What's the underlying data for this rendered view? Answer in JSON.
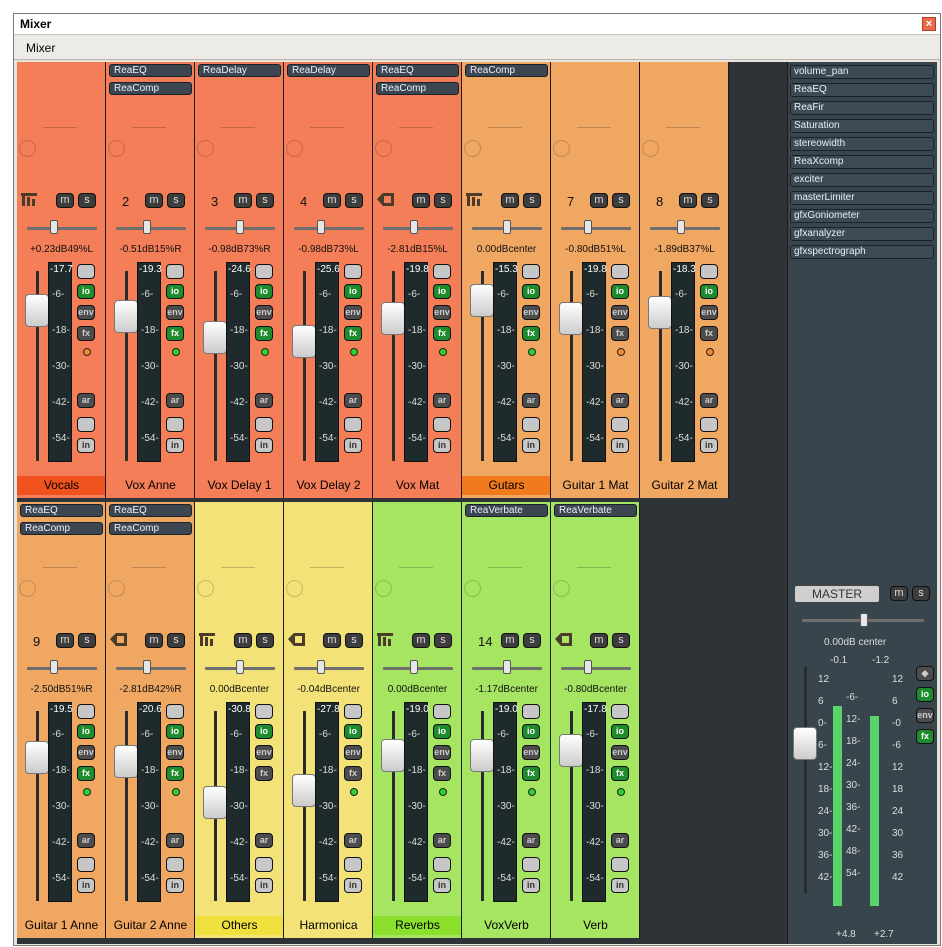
{
  "window": {
    "title": "Mixer",
    "tab_label": "Mixer",
    "close_glyph": "×"
  },
  "buttons": {
    "mute": "m",
    "solo": "s",
    "io": "io",
    "env": "env",
    "fx": "fx",
    "ar": "ar",
    "in": "in"
  },
  "tracks_row1": [
    {
      "num": "",
      "fx": [],
      "pan_text": "+0.23dB49%L",
      "peak": "-17.7",
      "name": "Vocals",
      "color": "#f47e57",
      "name_bg": "#f0521e",
      "folder": "parent",
      "fx_btn_active": false,
      "rec_dot": "orange"
    },
    {
      "num": "2",
      "fx": [
        "ReaEQ",
        "ReaComp"
      ],
      "pan_text": "-0.51dB15%R",
      "peak": "-19.3",
      "name": "Vox Anne",
      "color": "#f47e57",
      "name_bg": "#f47e57",
      "folder": "",
      "fx_btn_active": true,
      "rec_dot": "green"
    },
    {
      "num": "3",
      "fx": [
        "ReaDelay"
      ],
      "pan_text": "-0.98dB73%R",
      "peak": "-24.6",
      "name": "Vox Delay 1",
      "color": "#f47e57",
      "name_bg": "#f47e57",
      "folder": "",
      "fx_btn_active": true,
      "rec_dot": "green"
    },
    {
      "num": "4",
      "fx": [
        "ReaDelay"
      ],
      "pan_text": "-0.98dB73%L",
      "peak": "-25.6",
      "name": "Vox Delay 2",
      "color": "#f47e57",
      "name_bg": "#f47e57",
      "folder": "",
      "fx_btn_active": true,
      "rec_dot": "green"
    },
    {
      "num": "",
      "fx": [
        "ReaEQ",
        "ReaComp"
      ],
      "pan_text": "-2.81dB15%L",
      "peak": "-19.8",
      "name": "Vox Mat",
      "color": "#f47e57",
      "name_bg": "#f47e57",
      "folder": "child",
      "fx_btn_active": true,
      "rec_dot": "green"
    },
    {
      "num": "",
      "fx": [
        "ReaComp"
      ],
      "pan_text": "0.00dBcenter",
      "peak": "-15.3",
      "name": "Gutars",
      "color": "#f0a762",
      "name_bg": "#f07a1c",
      "folder": "parent",
      "fx_btn_active": true,
      "rec_dot": "green"
    },
    {
      "num": "7",
      "fx": [],
      "pan_text": "-0.80dB51%L",
      "peak": "-19.8",
      "name": "Guitar 1 Mat",
      "color": "#f0a762",
      "name_bg": "#f0a762",
      "folder": "",
      "fx_btn_active": false,
      "rec_dot": "orange"
    },
    {
      "num": "8",
      "fx": [],
      "pan_text": "-1.89dB37%L",
      "peak": "-18.3",
      "name": "Guitar 2 Mat",
      "color": "#f0a762",
      "name_bg": "#f0a762",
      "folder": "",
      "fx_btn_active": false,
      "rec_dot": "orange"
    }
  ],
  "tracks_row2": [
    {
      "num": "9",
      "fx": [
        "ReaEQ",
        "ReaComp"
      ],
      "pan_text": "-2.50dB51%R",
      "peak": "-19.5",
      "name": "Guitar 1 Anne",
      "color": "#f0a762",
      "name_bg": "#f0a762",
      "folder": "",
      "fx_btn_active": true,
      "rec_dot": "green"
    },
    {
      "num": "",
      "fx": [
        "ReaEQ",
        "ReaComp"
      ],
      "pan_text": "-2.81dB42%R",
      "peak": "-20.6",
      "name": "Guitar 2 Anne",
      "color": "#f0a762",
      "name_bg": "#f0a762",
      "folder": "child",
      "fx_btn_active": true,
      "rec_dot": "green"
    },
    {
      "num": "",
      "fx": [],
      "pan_text": "0.00dBcenter",
      "peak": "-30.8",
      "name": "Others",
      "color": "#f3e277",
      "name_bg": "#efe03d",
      "folder": "parent",
      "fx_btn_active": false,
      "rec_dot": "none"
    },
    {
      "num": "",
      "fx": [],
      "pan_text": "-0.04dBcenter",
      "peak": "-27.8",
      "name": "Harmonica",
      "color": "#f3e277",
      "name_bg": "#f3e277",
      "folder": "child",
      "fx_btn_active": false,
      "rec_dot": "green"
    },
    {
      "num": "",
      "fx": [],
      "pan_text": "0.00dBcenter",
      "peak": "-19.0",
      "name": "Reverbs",
      "color": "#a6e562",
      "name_bg": "#8be02e",
      "folder": "parent",
      "fx_btn_active": false,
      "rec_dot": "green"
    },
    {
      "num": "14",
      "fx": [
        "ReaVerbate"
      ],
      "pan_text": "-1.17dBcenter",
      "peak": "-19.0",
      "name": "VoxVerb",
      "color": "#a6e562",
      "name_bg": "#a6e562",
      "folder": "",
      "fx_btn_active": true,
      "rec_dot": "green"
    },
    {
      "num": "",
      "fx": [
        "ReaVerbate"
      ],
      "pan_text": "-0.80dBcenter",
      "peak": "-17.8",
      "name": "Verb",
      "color": "#a6e562",
      "name_bg": "#a6e562",
      "folder": "child",
      "fx_btn_active": true,
      "rec_dot": "green"
    }
  ],
  "meter_ticks": [
    "-6-",
    "-18-",
    "-30-",
    "-42-",
    "-54-"
  ],
  "master": {
    "fx": [
      "volume_pan",
      "ReaEQ",
      "ReaFir",
      "Saturation",
      "stereowidth",
      "ReaXcomp",
      "exciter",
      "masterLimiter",
      "gfxGoniometer",
      "gfxanalyzer",
      "gfxspectrograph"
    ],
    "label": "MASTER",
    "pan_text": "0.00dB center",
    "peak_left": "-0.1",
    "peak_right": "-1.2",
    "ticks_left": [
      "12",
      "6",
      "0-",
      "6-",
      "12-",
      "18-",
      "24-",
      "30-",
      "36-",
      "42-"
    ],
    "ticks_right": [
      "12",
      "6",
      "-0",
      "-6",
      "12",
      "18",
      "24",
      "30",
      "36",
      "42"
    ],
    "ticks_mid": [
      "-6-",
      "12-",
      "18-",
      "24-",
      "30-",
      "36-",
      "42-",
      "48-",
      "54-"
    ],
    "bottom_left": "+4.8",
    "bottom_right": "+2.7",
    "mono_glyph": "◆"
  }
}
